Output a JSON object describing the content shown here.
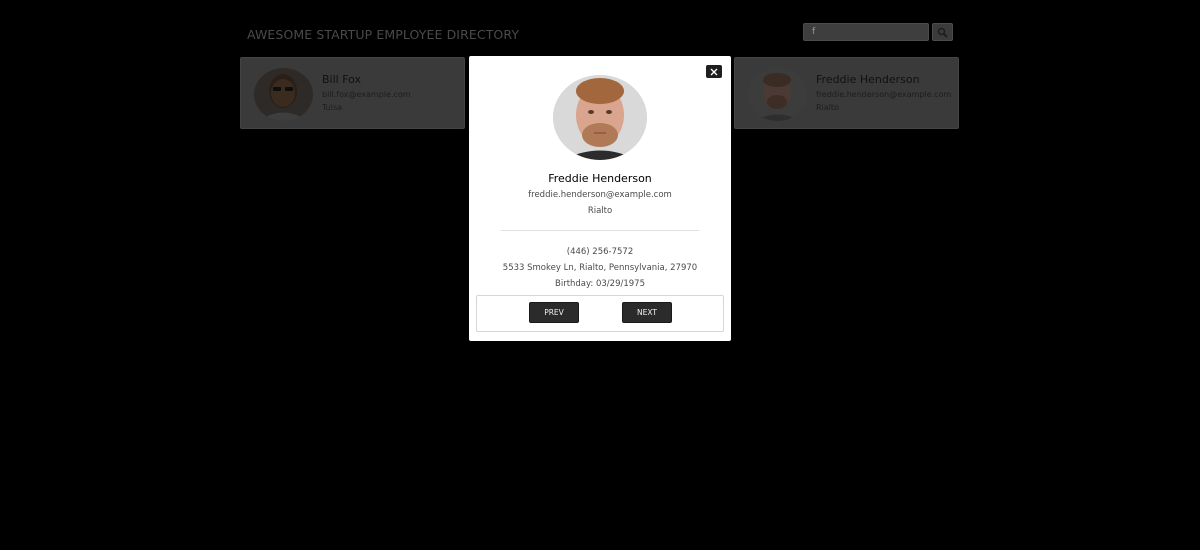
{
  "header": {
    "title": "AWESOME STARTUP EMPLOYEE DIRECTORY"
  },
  "search": {
    "value": "f",
    "button_icon": "search-icon"
  },
  "cards": [
    {
      "name": "Bill Fox",
      "email": "bill.fox@example.com",
      "city": "Tulsa"
    },
    {
      "name": "Freddie Henderson",
      "email": "freddie.henderson@example.com",
      "city": "Rialto"
    }
  ],
  "modal": {
    "close_icon": "close-icon",
    "name": "Freddie Henderson",
    "email": "freddie.henderson@example.com",
    "city": "Rialto",
    "phone": "(446) 256-7572",
    "address": "5533 Smokey Ln, Rialto, Pennsylvania, 27970",
    "birthday": "Birthday: 03/29/1975",
    "prev_label": "PREV",
    "next_label": "NEXT"
  },
  "colors": {
    "overlay": "#000000",
    "card_bg": "#3a3a3a",
    "modal_bg": "#ffffff",
    "button_bg": "#2b2b2b"
  }
}
